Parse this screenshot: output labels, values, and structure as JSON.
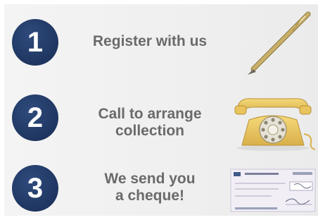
{
  "steps": [
    {
      "number": "1",
      "line1": "Register with us",
      "line2": ""
    },
    {
      "number": "2",
      "line1": "Call to arrange",
      "line2": "collection"
    },
    {
      "number": "3",
      "line1": "We send you",
      "line2": "a cheque!"
    }
  ],
  "illustrations": [
    "pen",
    "telephone",
    "cheque"
  ],
  "colors": {
    "circle": "#223a66",
    "text": "#6a6a6a",
    "background": "#efefef"
  }
}
